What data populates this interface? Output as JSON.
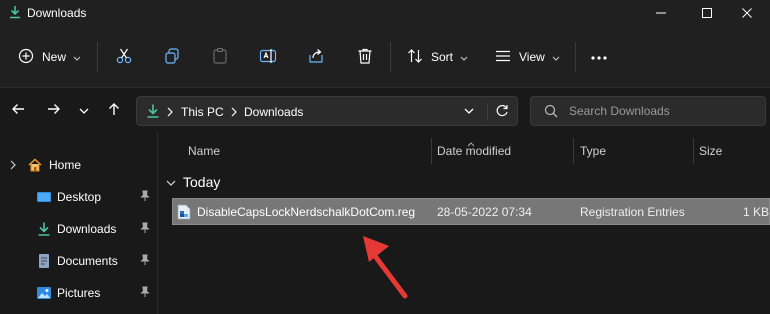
{
  "window": {
    "title": "Downloads"
  },
  "toolbar": {
    "new_label": "New",
    "sort_label": "Sort",
    "view_label": "View"
  },
  "address": {
    "crumbs": [
      "This PC",
      "Downloads"
    ]
  },
  "search": {
    "placeholder": "Search Downloads"
  },
  "sidebar": {
    "items": [
      {
        "label": "Home",
        "icon": "home-icon",
        "pinned": false
      },
      {
        "label": "Desktop",
        "icon": "desktop-icon",
        "pinned": true
      },
      {
        "label": "Downloads",
        "icon": "download-icon",
        "pinned": true
      },
      {
        "label": "Documents",
        "icon": "documents-icon",
        "pinned": true
      },
      {
        "label": "Pictures",
        "icon": "pictures-icon",
        "pinned": true
      }
    ]
  },
  "columns": [
    "Name",
    "Date modified",
    "Type",
    "Size"
  ],
  "group": {
    "label": "Today"
  },
  "files": [
    {
      "name": "DisableCapsLockNerdschalkDotCom.reg",
      "date": "28-05-2022 07:34",
      "type": "Registration Entries",
      "size": "1 KB"
    }
  ],
  "colors": {
    "accent": "#4cc2a5",
    "selection": "#777777",
    "annotation_arrow": "#e53935"
  }
}
